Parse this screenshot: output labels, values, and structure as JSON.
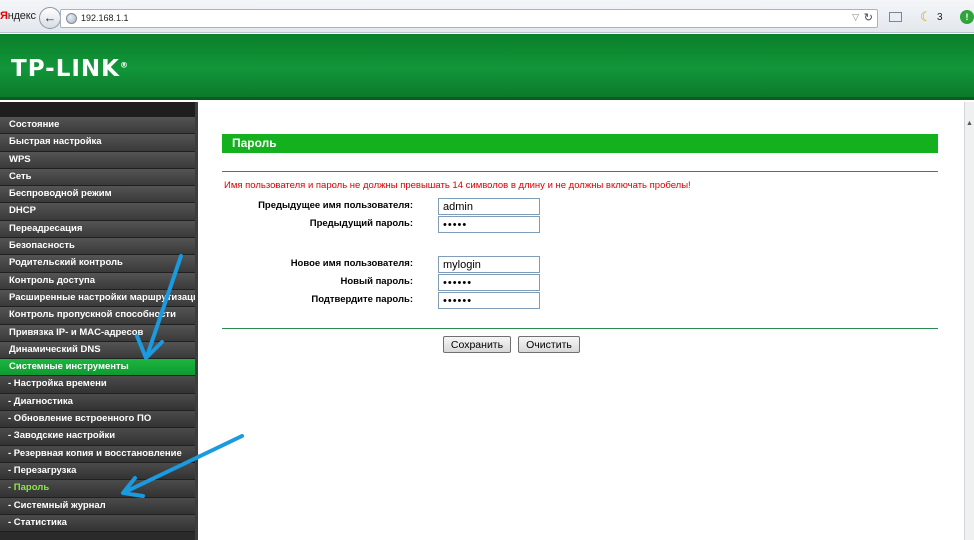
{
  "browser": {
    "brand_first": "Я",
    "brand_rest": "ндекс",
    "url": "192.168.1.1",
    "notification_count": "3",
    "status_badge": "!"
  },
  "header": {
    "logo_text": "TP-LINK",
    "logo_mark": "®"
  },
  "menu": {
    "items": [
      {
        "label": "Состояние",
        "type": "main",
        "state": "normal"
      },
      {
        "label": "Быстрая настройка",
        "type": "main",
        "state": "normal"
      },
      {
        "label": "WPS",
        "type": "main",
        "state": "normal"
      },
      {
        "label": "Сеть",
        "type": "main",
        "state": "normal"
      },
      {
        "label": "Беспроводной режим",
        "type": "main",
        "state": "normal"
      },
      {
        "label": "DHCP",
        "type": "main",
        "state": "normal"
      },
      {
        "label": "Переадресация",
        "type": "main",
        "state": "normal"
      },
      {
        "label": "Безопасность",
        "type": "main",
        "state": "normal"
      },
      {
        "label": "Родительский контроль",
        "type": "main",
        "state": "normal"
      },
      {
        "label": "Контроль доступа",
        "type": "main",
        "state": "normal"
      },
      {
        "label": "Расширенные настройки маршрутизации",
        "type": "main",
        "state": "normal"
      },
      {
        "label": "Контроль пропускной способности",
        "type": "main",
        "state": "normal"
      },
      {
        "label": "Привязка IP- и MAC-адресов",
        "type": "main",
        "state": "normal"
      },
      {
        "label": "Динамический DNS",
        "type": "main",
        "state": "normal"
      },
      {
        "label": "Системные инструменты",
        "type": "main",
        "state": "active"
      },
      {
        "label": "- Настройка времени",
        "type": "sub",
        "state": "normal"
      },
      {
        "label": "- Диагностика",
        "type": "sub",
        "state": "normal"
      },
      {
        "label": "- Обновление встроенного ПО",
        "type": "sub",
        "state": "normal"
      },
      {
        "label": "- Заводские настройки",
        "type": "sub",
        "state": "normal"
      },
      {
        "label": "- Резервная копия и восстановление",
        "type": "sub",
        "state": "normal"
      },
      {
        "label": "- Перезагрузка",
        "type": "sub",
        "state": "normal"
      },
      {
        "label": "- Пароль",
        "type": "sub",
        "state": "active"
      },
      {
        "label": "- Системный журнал",
        "type": "sub",
        "state": "normal"
      },
      {
        "label": "- Статистика",
        "type": "sub",
        "state": "normal"
      }
    ]
  },
  "content": {
    "title": "Пароль",
    "warning": "Имя пользователя и пароль не должны превышать 14 символов в длину и не должны включать пробелы!",
    "fields": {
      "old_username": {
        "label": "Предыдущее имя пользователя:",
        "value": "admin"
      },
      "old_password": {
        "label": "Предыдущий пароль:",
        "value": "•••••"
      },
      "new_username": {
        "label": "Новое имя пользователя:",
        "value": "mylogin"
      },
      "new_password": {
        "label": "Новый пароль:",
        "value": "••••••"
      },
      "confirm_password": {
        "label": "Подтвердите пароль:",
        "value": "••••••"
      }
    },
    "save_label": "Сохранить",
    "clear_label": "Очистить"
  },
  "colors": {
    "header_green": "#12963a",
    "title_green": "#14b11e",
    "warning_red": "#e00000",
    "menu_dark": "#3a3a3a",
    "active_sub_text": "#8ae84a",
    "annotation_arrow": "#1a9ae0"
  }
}
